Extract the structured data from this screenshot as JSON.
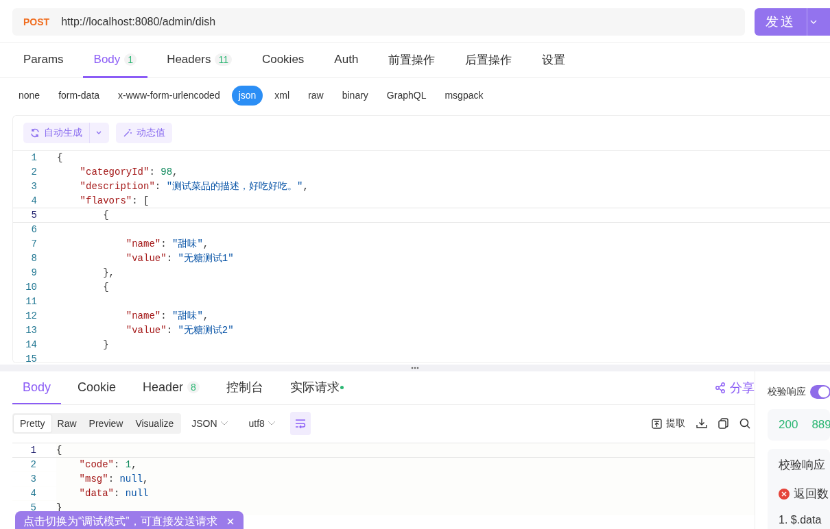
{
  "request": {
    "method": "POST",
    "url": "http://localhost:8080/admin/dish",
    "send_label": "发送"
  },
  "request_tabs": [
    {
      "label": "Params",
      "selected": false
    },
    {
      "label": "Body",
      "badge": "1",
      "selected": true
    },
    {
      "label": "Headers",
      "badge": "11",
      "selected": false
    },
    {
      "label": "Cookies",
      "selected": false
    },
    {
      "label": "Auth",
      "selected": false
    },
    {
      "label": "前置操作",
      "selected": false
    },
    {
      "label": "后置操作",
      "selected": false
    },
    {
      "label": "设置",
      "selected": false
    }
  ],
  "body_types": [
    {
      "label": "none",
      "selected": false
    },
    {
      "label": "form-data",
      "selected": false
    },
    {
      "label": "x-www-form-urlencoded",
      "selected": false
    },
    {
      "label": "json",
      "selected": true
    },
    {
      "label": "xml",
      "selected": false
    },
    {
      "label": "raw",
      "selected": false
    },
    {
      "label": "binary",
      "selected": false
    },
    {
      "label": "GraphQL",
      "selected": false
    },
    {
      "label": "msgpack",
      "selected": false
    }
  ],
  "editor_toolbar": [
    {
      "kind": "generate",
      "label": "自动生成"
    },
    {
      "kind": "dynamic",
      "label": "动态值"
    }
  ],
  "request_body": [
    {
      "number": "1",
      "active": false,
      "tokens": [
        {
          "kind": "punct",
          "text": "{"
        }
      ]
    },
    {
      "number": "2",
      "active": false,
      "tokens": [
        {
          "kind": "key",
          "text": "    \"categoryId\""
        },
        {
          "kind": "punct",
          "text": ": "
        },
        {
          "kind": "num",
          "text": "98"
        },
        {
          "kind": "punct",
          "text": ","
        }
      ]
    },
    {
      "number": "3",
      "active": false,
      "tokens": [
        {
          "kind": "key",
          "text": "    \"description\""
        },
        {
          "kind": "punct",
          "text": ": "
        },
        {
          "kind": "str",
          "text": "\"测试菜品的描述，好吃好吃。\""
        },
        {
          "kind": "punct",
          "text": ","
        }
      ]
    },
    {
      "number": "4",
      "active": false,
      "tokens": [
        {
          "kind": "key",
          "text": "    \"flavors\""
        },
        {
          "kind": "punct",
          "text": ": ["
        }
      ]
    },
    {
      "number": "5",
      "active": true,
      "tokens": [
        {
          "kind": "punct",
          "text": "        {"
        }
      ]
    },
    {
      "number": "6",
      "active": false
    },
    {
      "number": "7",
      "active": false,
      "tokens": [
        {
          "kind": "key",
          "text": "            \"name\""
        },
        {
          "kind": "punct",
          "text": ": "
        },
        {
          "kind": "str",
          "text": "\"甜味\""
        },
        {
          "kind": "punct",
          "text": ","
        }
      ]
    },
    {
      "number": "8",
      "active": false,
      "tokens": [
        {
          "kind": "key",
          "text": "            \"value\""
        },
        {
          "kind": "punct",
          "text": ": "
        },
        {
          "kind": "str",
          "text": "\"无糖测试1\""
        }
      ]
    },
    {
      "number": "9",
      "active": false,
      "tokens": [
        {
          "kind": "punct",
          "text": "        },"
        }
      ]
    },
    {
      "number": "10",
      "active": false,
      "tokens": [
        {
          "kind": "punct",
          "text": "        {"
        }
      ]
    },
    {
      "number": "11",
      "active": false
    },
    {
      "number": "12",
      "active": false,
      "tokens": [
        {
          "kind": "key",
          "text": "            \"name\""
        },
        {
          "kind": "punct",
          "text": ": "
        },
        {
          "kind": "str",
          "text": "\"甜味\""
        },
        {
          "kind": "punct",
          "text": ","
        }
      ]
    },
    {
      "number": "13",
      "active": false,
      "tokens": [
        {
          "kind": "key",
          "text": "            \"value\""
        },
        {
          "kind": "punct",
          "text": ": "
        },
        {
          "kind": "str",
          "text": "\"无糖测试2\""
        }
      ]
    },
    {
      "number": "14",
      "active": false,
      "tokens": [
        {
          "kind": "punct",
          "text": "        }"
        }
      ]
    },
    {
      "number": "15",
      "active": false
    }
  ],
  "response_tabs": [
    {
      "label": "Body",
      "selected": true
    },
    {
      "label": "Cookie",
      "selected": false
    },
    {
      "label": "Header",
      "badge": "8",
      "selected": false
    },
    {
      "label": "控制台",
      "selected": false
    },
    {
      "label": "实际请求",
      "dot": true,
      "selected": false
    }
  ],
  "share_label": "分享",
  "view_modes": [
    {
      "label": "Pretty",
      "selected": true
    },
    {
      "label": "Raw",
      "selected": false
    },
    {
      "label": "Preview",
      "selected": false
    },
    {
      "label": "Visualize",
      "selected": false
    }
  ],
  "format_dropdowns": [
    "JSON",
    "utf8"
  ],
  "wrap_on": true,
  "extract_label": "提取",
  "response_body": [
    {
      "number": "1",
      "active": true,
      "tokens": [
        {
          "kind": "punct",
          "text": "{"
        }
      ]
    },
    {
      "number": "2",
      "active": false,
      "tokens": [
        {
          "kind": "key",
          "text": "    \"code\""
        },
        {
          "kind": "punct",
          "text": ": "
        },
        {
          "kind": "num",
          "text": "1"
        },
        {
          "kind": "punct",
          "text": ","
        }
      ]
    },
    {
      "number": "3",
      "active": false,
      "tokens": [
        {
          "kind": "key",
          "text": "    \"msg\""
        },
        {
          "kind": "punct",
          "text": ": "
        },
        {
          "kind": "kw",
          "text": "null"
        },
        {
          "kind": "punct",
          "text": ","
        }
      ]
    },
    {
      "number": "4",
      "active": false,
      "tokens": [
        {
          "kind": "key",
          "text": "    \"data\""
        },
        {
          "kind": "punct",
          "text": ": "
        },
        {
          "kind": "kw",
          "text": "null"
        }
      ]
    },
    {
      "number": "5",
      "active": false,
      "tokens": [
        {
          "kind": "punct",
          "text": "}"
        }
      ]
    }
  ],
  "validation": {
    "label": "校验响应",
    "on": true,
    "status": "200",
    "time": "889",
    "title": "校验响应",
    "error": "返回数",
    "rule": "1. $.data"
  },
  "toast": "点击切换为“调试模式”，可直接发送请求"
}
